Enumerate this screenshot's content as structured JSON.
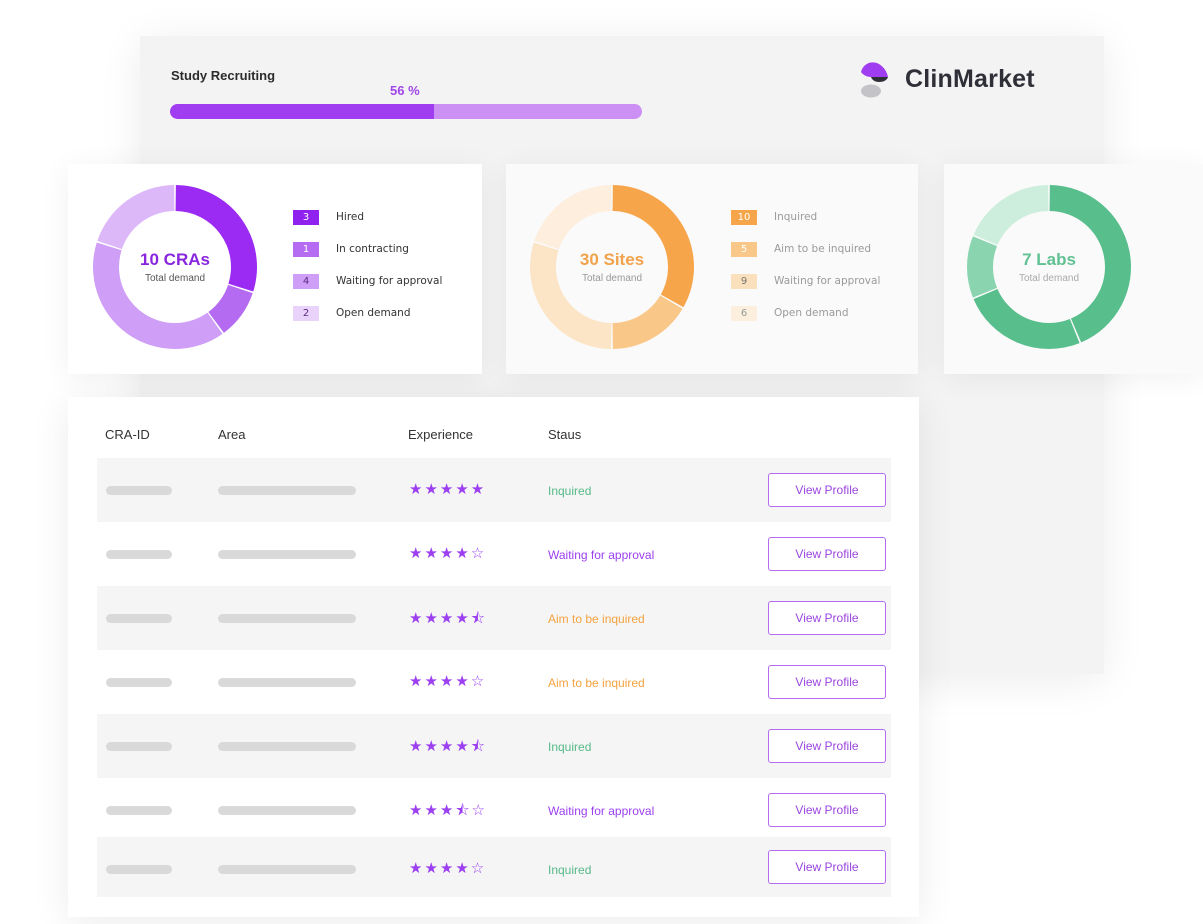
{
  "header": {
    "study_label": "Study Recruiting",
    "progress_label": "56 %",
    "progress_fraction": 0.56,
    "brand": "ClinMarket"
  },
  "colors": {
    "purple_dark": "#9B2BF2",
    "purple_mid": "#B46BF1",
    "purple_light": "#DDB8F9",
    "orange_dark": "#F7A54A",
    "orange_mid": "#F9C787",
    "orange_light": "#FCE5C6",
    "green_dark": "#57BE8C",
    "green_mid": "#8AD5B0",
    "green_light": "#CDEEDD"
  },
  "cards": {
    "cras": {
      "value": "10 CRAs",
      "sub": "Total demand",
      "legend": [
        {
          "count": "3",
          "label": "Hired"
        },
        {
          "count": "1",
          "label": "In contracting"
        },
        {
          "count": "4",
          "label": "Waiting for approval"
        },
        {
          "count": "2",
          "label": "Open demand"
        }
      ]
    },
    "sites": {
      "value": "30 Sites",
      "sub": "Total demand",
      "legend": [
        {
          "count": "10",
          "label": "Inquired"
        },
        {
          "count": "5",
          "label": "Aim to be inquired"
        },
        {
          "count": "9",
          "label": "Waiting for approval"
        },
        {
          "count": "6",
          "label": "Open demand"
        }
      ]
    },
    "labs": {
      "value": "7 Labs",
      "sub": "Total demand"
    }
  },
  "table": {
    "headers": [
      "CRA-ID",
      "Area",
      "Experience",
      "Staus"
    ],
    "button_label": "View Profile",
    "rows": [
      {
        "stars": "★★★★★",
        "rating": 5,
        "status": "Inquired"
      },
      {
        "stars": "★★★★☆",
        "rating": 4,
        "status": "Waiting for approval"
      },
      {
        "stars": "★★★★⯪",
        "rating": 4.5,
        "status": "Aim to be inquired"
      },
      {
        "stars": "★★★★☆",
        "rating": 4,
        "status": "Aim to be inquired"
      },
      {
        "stars": "★★★★⯪",
        "rating": 4.5,
        "status": "Inquired"
      },
      {
        "stars": "★★★⯪☆",
        "rating": 3.5,
        "status": "Waiting for approval"
      },
      {
        "stars": "★★★★☆",
        "rating": 4,
        "status": "Inquired"
      }
    ]
  }
}
